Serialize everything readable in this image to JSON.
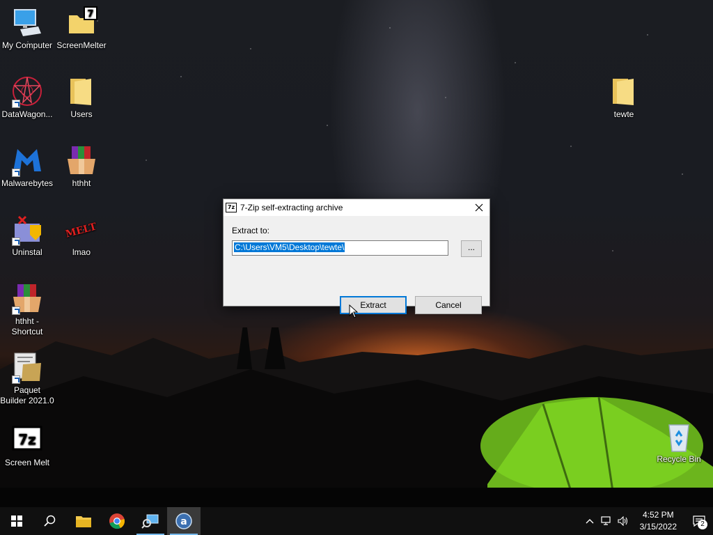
{
  "desktop": {
    "icons": [
      {
        "label": "My Computer",
        "icon": "computer-icon"
      },
      {
        "label": "ScreenMelter",
        "icon": "7zip-folder-icon"
      },
      {
        "label": "DataWagon...",
        "icon": "datawagon-icon"
      },
      {
        "label": "Users",
        "icon": "folder-icon"
      },
      {
        "label": "Malwarebytes",
        "icon": "malwarebytes-icon"
      },
      {
        "label": "hthht",
        "icon": "winrar-archive-icon"
      },
      {
        "label": "Uninstal",
        "icon": "uninstall-icon"
      },
      {
        "label": "lmao",
        "icon": "melt-icon"
      },
      {
        "label": "hthht - Shortcut",
        "icon": "winrar-archive-icon"
      },
      {
        "label": "Paquet Builder 2021.0",
        "icon": "paquet-builder-icon"
      },
      {
        "label": "Screen Melt",
        "icon": "7zip-icon"
      },
      {
        "label": "tewte",
        "icon": "folder-icon"
      },
      {
        "label": "Recycle Bin",
        "icon": "recycle-bin-icon"
      }
    ],
    "melt_text": "MELT"
  },
  "dialog": {
    "logo": "7z",
    "title": "7-Zip self-extracting archive",
    "extract_label": "Extract to:",
    "path_value": "C:\\Users\\VM5\\Desktop\\tewte\\",
    "browse_label": "...",
    "extract_button": "Extract",
    "cancel_button": "Cancel"
  },
  "taskbar": {
    "apps": [
      "start-icon",
      "search-icon",
      "file-explorer-icon",
      "chrome-icon",
      "network-app-icon",
      "archive-app-icon"
    ],
    "time": "4:52 PM",
    "date": "3/15/2022",
    "notification_count": "2"
  },
  "colors": {
    "accent": "#0078d7",
    "taskbar": "#101010",
    "dialog_bg": "#f0f0f0"
  }
}
